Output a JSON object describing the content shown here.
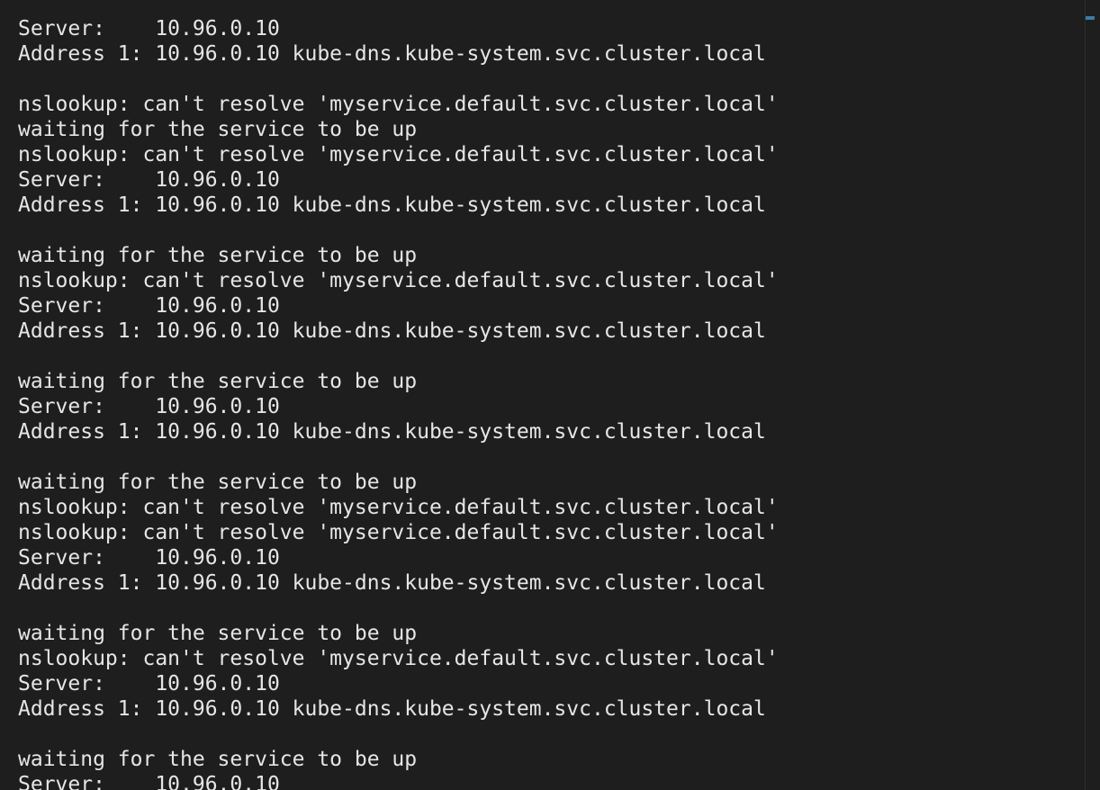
{
  "terminal": {
    "lines": [
      "Server:    10.96.0.10",
      "Address 1: 10.96.0.10 kube-dns.kube-system.svc.cluster.local",
      "",
      "nslookup: can't resolve 'myservice.default.svc.cluster.local'",
      "waiting for the service to be up",
      "nslookup: can't resolve 'myservice.default.svc.cluster.local'",
      "Server:    10.96.0.10",
      "Address 1: 10.96.0.10 kube-dns.kube-system.svc.cluster.local",
      "",
      "waiting for the service to be up",
      "nslookup: can't resolve 'myservice.default.svc.cluster.local'",
      "Server:    10.96.0.10",
      "Address 1: 10.96.0.10 kube-dns.kube-system.svc.cluster.local",
      "",
      "waiting for the service to be up",
      "Server:    10.96.0.10",
      "Address 1: 10.96.0.10 kube-dns.kube-system.svc.cluster.local",
      "",
      "waiting for the service to be up",
      "nslookup: can't resolve 'myservice.default.svc.cluster.local'",
      "nslookup: can't resolve 'myservice.default.svc.cluster.local'",
      "Server:    10.96.0.10",
      "Address 1: 10.96.0.10 kube-dns.kube-system.svc.cluster.local",
      "",
      "waiting for the service to be up",
      "nslookup: can't resolve 'myservice.default.svc.cluster.local'",
      "Server:    10.96.0.10",
      "Address 1: 10.96.0.10 kube-dns.kube-system.svc.cluster.local",
      "",
      "waiting for the service to be up",
      "Server:    10.96.0.10"
    ]
  },
  "colors": {
    "background": "#1e1e1e",
    "text": "#e6e6e6",
    "scroll_thumb": "#3a7ca5"
  }
}
